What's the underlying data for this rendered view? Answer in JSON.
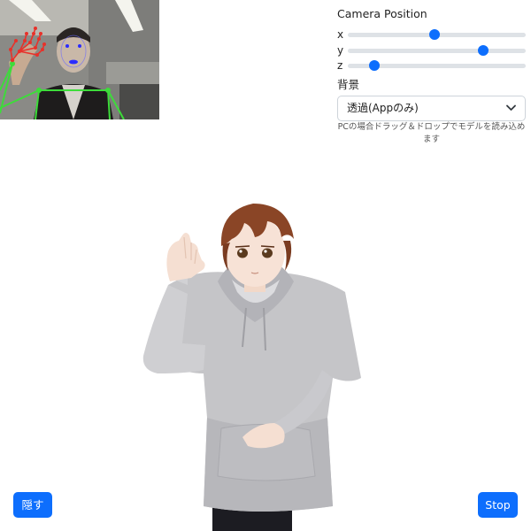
{
  "camera": {
    "title": "Camera Position",
    "axes": [
      {
        "label": "x",
        "value": 0.49
      },
      {
        "label": "y",
        "value": 0.76
      },
      {
        "label": "z",
        "value": 0.15
      }
    ]
  },
  "background": {
    "label": "背景",
    "selected": "透過(Appのみ)",
    "hint": "PCの場合ドラッグ＆ドロップでモデルを読み込めます"
  },
  "buttons": {
    "hide_label": "隠す",
    "stop_label": "Stop"
  },
  "colors": {
    "accent": "#0d6efd",
    "hand_landmarks": "#e8312a",
    "pose_landmarks": "#3ddc3a",
    "face_landmarks": "#2b2bff"
  }
}
